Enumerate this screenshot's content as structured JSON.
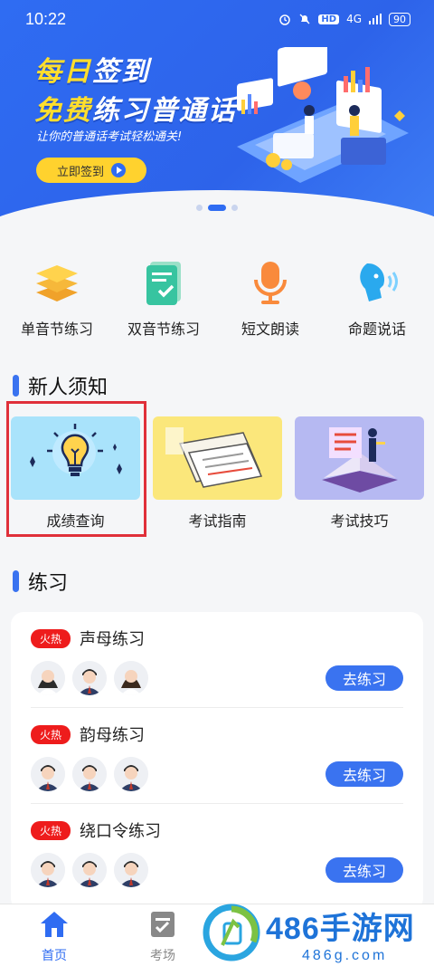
{
  "status_bar": {
    "time": "10:22",
    "hd_label": "HD",
    "network_label": "4G",
    "battery_level": "90"
  },
  "banner": {
    "title_line1_accent": "每日",
    "title_line1_rest": "签到",
    "title_line2_accent": "免费",
    "title_line2_rest": "练习普通话",
    "subtitle": "让你的普通话考试轻松通关!",
    "button_label": "立即签到",
    "carousel_count": 3,
    "carousel_active": 1
  },
  "quick_actions": [
    {
      "label": "单音节练习",
      "icon": "stack-layers-icon"
    },
    {
      "label": "双音节练习",
      "icon": "document-check-icon"
    },
    {
      "label": "短文朗读",
      "icon": "microphone-icon"
    },
    {
      "label": "命题说话",
      "icon": "speaking-head-icon"
    }
  ],
  "newcomer": {
    "title": "新人须知",
    "cards": [
      {
        "label": "成绩查询",
        "icon": "lightbulb-icon"
      },
      {
        "label": "考试指南",
        "icon": "paper-stack-icon"
      },
      {
        "label": "考试技巧",
        "icon": "book-presenter-icon"
      }
    ]
  },
  "practice": {
    "title": "练习",
    "items": [
      {
        "tag": "火热",
        "name": "声母练习",
        "button": "去练习",
        "avatars": [
          "female",
          "male",
          "female"
        ]
      },
      {
        "tag": "火热",
        "name": "韵母练习",
        "button": "去练习",
        "avatars": [
          "male",
          "male",
          "male"
        ]
      },
      {
        "tag": "火热",
        "name": "绕口令练习",
        "button": "去练习",
        "avatars": [
          "male",
          "male",
          "male"
        ]
      }
    ]
  },
  "bottom_nav": {
    "home": "首页",
    "exam": "考场"
  },
  "watermark": {
    "main": "486手游网",
    "sub": "486g.com"
  },
  "colors": {
    "primary": "#2f6cf2",
    "hot_tag": "#ee1c1c",
    "highlight_box": "#e0303a",
    "banner_accent": "#ffde2d"
  }
}
